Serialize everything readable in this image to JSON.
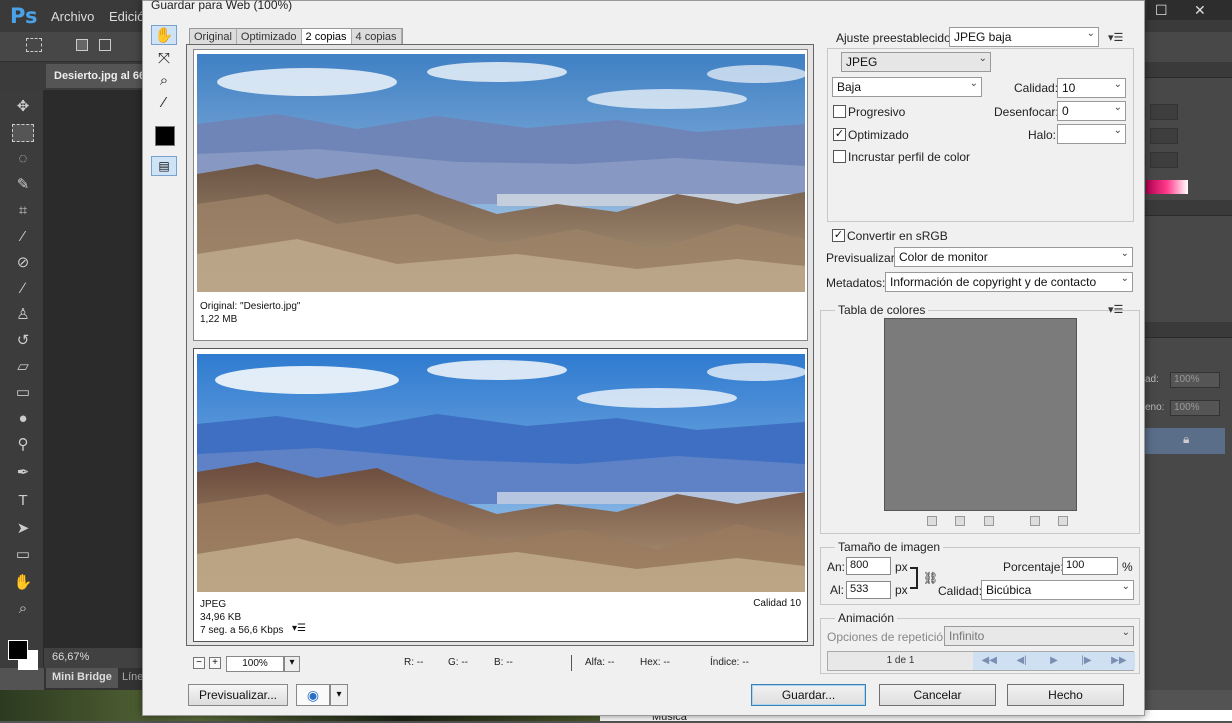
{
  "photoshop": {
    "logo": "Ps",
    "menu": [
      "Archivo",
      "Edició"
    ],
    "doc_tab": "Desierto.jpg al 66",
    "zoom_status": "66,67%",
    "panel_tabs": [
      "Mini Bridge",
      "Líne"
    ],
    "right_labels": [
      "ad:",
      "eno:"
    ],
    "right_values": [
      "100%",
      "100%"
    ],
    "explorer_item": "Música",
    "window_controls": [
      "☐",
      "✕"
    ]
  },
  "dialog": {
    "title": "Guardar para Web (100%)",
    "tabs": [
      "Original",
      "Optimizado",
      "2 copias",
      "4 copias"
    ],
    "active_tab": "2 copias",
    "original": {
      "name": "Original: \"Desierto.jpg\"",
      "size": "1,22 MB"
    },
    "optimized": {
      "format": "JPEG",
      "size": "34,96 KB",
      "time": "7 seg. a 56,6 Kbps",
      "quality": "Calidad 10"
    },
    "zoom": {
      "value": "100%",
      "minus": "−",
      "plus": "+"
    },
    "pixel_info": {
      "r": "R: --",
      "g": "G: --",
      "b": "B: --",
      "alpha": "Alfa: --",
      "hex": "Hex: --",
      "index": "Índice: --"
    },
    "buttons": {
      "preview": "Previsualizar...",
      "save": "Guardar...",
      "cancel": "Cancelar",
      "done": "Hecho"
    },
    "settings": {
      "preset_label": "Ajuste preestablecido:",
      "preset_value": "JPEG baja",
      "format_value": "JPEG",
      "quality_preset": "Baja",
      "quality_label": "Calidad:",
      "quality_value": "10",
      "progressive_label": "Progresivo",
      "progressive": false,
      "blur_label": "Desenfocar:",
      "blur_value": "0",
      "optimized_label": "Optimizado",
      "optimized": true,
      "matte_label": "Halo:",
      "matte_value": "",
      "embed_label": "Incrustar perfil de color",
      "embed": false,
      "srgb_label": "Convertir en sRGB",
      "srgb": true,
      "preview_label": "Previsualizar:",
      "preview_value": "Color de monitor",
      "metadata_label": "Metadatos:",
      "metadata_value": "Información de copyright y de contacto"
    },
    "color_table": {
      "label": "Tabla de colores"
    },
    "image_size": {
      "label": "Tamaño de imagen",
      "width_label": "An:",
      "width": "800",
      "height_label": "Al:",
      "height": "533",
      "unit": "px",
      "percent_label": "Porcentaje:",
      "percent": "100",
      "percent_unit": "%",
      "quality_label": "Calidad:",
      "quality_value": "Bicúbica"
    },
    "animation": {
      "label": "Animación",
      "loop_label": "Opciones de repetición:",
      "loop_value": "Infinito",
      "frame_count": "1 de 1"
    }
  }
}
